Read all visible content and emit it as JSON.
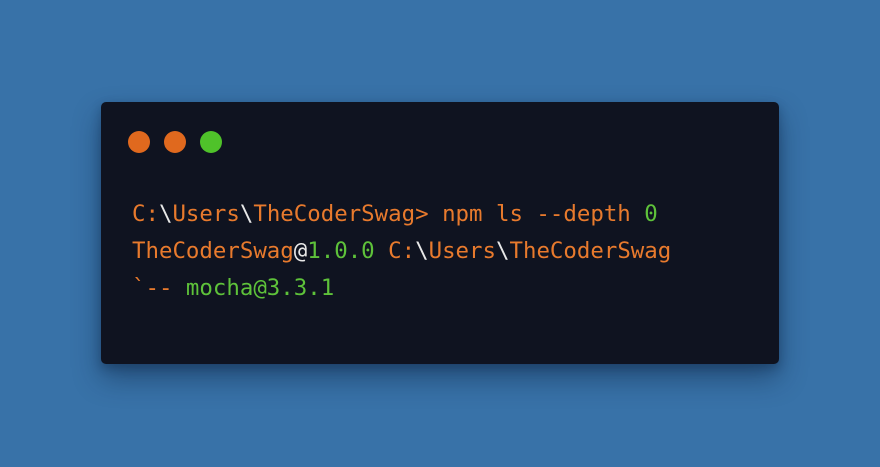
{
  "colors": {
    "background": "#3872a8",
    "terminal_bg": "#0f1320",
    "orange": "#e87a2d",
    "green": "#5ec23a",
    "white": "#e8e8e8",
    "dot_close": "#e0691e",
    "dot_minimize": "#e0691e",
    "dot_maximize": "#4fc22a"
  },
  "window_controls": [
    {
      "name": "close",
      "icon": "close-dot-icon"
    },
    {
      "name": "minimize",
      "icon": "minimize-dot-icon"
    },
    {
      "name": "maximize",
      "icon": "maximize-dot-icon"
    }
  ],
  "terminal": {
    "lines": [
      {
        "segments": [
          {
            "text": "C:",
            "color": "orange"
          },
          {
            "text": "\\",
            "color": "white"
          },
          {
            "text": "Users",
            "color": "orange"
          },
          {
            "text": "\\",
            "color": "white"
          },
          {
            "text": "TheCoderSwag> npm ls --depth ",
            "color": "orange"
          },
          {
            "text": "0",
            "color": "green"
          }
        ]
      },
      {
        "segments": [
          {
            "text": "TheCoderSwag",
            "color": "orange"
          },
          {
            "text": "@",
            "color": "white"
          },
          {
            "text": "1.0.0",
            "color": "green"
          },
          {
            "text": " C:",
            "color": "orange"
          },
          {
            "text": "\\",
            "color": "white"
          },
          {
            "text": "Users",
            "color": "orange"
          },
          {
            "text": "\\",
            "color": "white"
          },
          {
            "text": "TheCoderSwag",
            "color": "orange"
          }
        ]
      },
      {
        "segments": [
          {
            "text": "`-- ",
            "color": "orange"
          },
          {
            "text": "mocha@3.3.1",
            "color": "green"
          }
        ]
      }
    ]
  }
}
